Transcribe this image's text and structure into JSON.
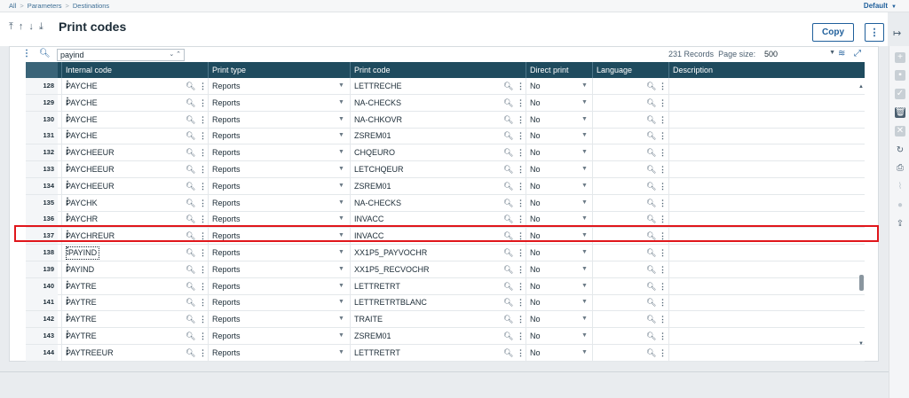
{
  "breadcrumb": [
    "All",
    "Parameters",
    "Destinations"
  ],
  "profile": {
    "label": "Default"
  },
  "header": {
    "title": "Print codes",
    "copy_label": "Copy",
    "more_label": "⋮"
  },
  "toolbar": {
    "filter_value": "payind",
    "records_count": "231",
    "records_label": "Records",
    "page_size_label": "Page size:",
    "page_size_value": "500"
  },
  "columns": {
    "internal_code": "Internal code",
    "print_type": "Print type",
    "print_code": "Print code",
    "direct_print": "Direct print",
    "language": "Language",
    "description": "Description"
  },
  "rows": [
    {
      "n": "128",
      "code": "PAYCHE",
      "type": "Reports",
      "print_code": "LETTRECHE",
      "direct": "No"
    },
    {
      "n": "129",
      "code": "PAYCHE",
      "type": "Reports",
      "print_code": "NA-CHECKS",
      "direct": "No"
    },
    {
      "n": "130",
      "code": "PAYCHE",
      "type": "Reports",
      "print_code": "NA-CHKOVR",
      "direct": "No"
    },
    {
      "n": "131",
      "code": "PAYCHE",
      "type": "Reports",
      "print_code": "ZSREM01",
      "direct": "No"
    },
    {
      "n": "132",
      "code": "PAYCHEEUR",
      "type": "Reports",
      "print_code": "CHQEURO",
      "direct": "No"
    },
    {
      "n": "133",
      "code": "PAYCHEEUR",
      "type": "Reports",
      "print_code": "LETCHQEUR",
      "direct": "No"
    },
    {
      "n": "134",
      "code": "PAYCHEEUR",
      "type": "Reports",
      "print_code": "ZSREM01",
      "direct": "No"
    },
    {
      "n": "135",
      "code": "PAYCHK",
      "type": "Reports",
      "print_code": "NA-CHECKS",
      "direct": "No"
    },
    {
      "n": "136",
      "code": "PAYCHR",
      "type": "Reports",
      "print_code": "INVACC",
      "direct": "No"
    },
    {
      "n": "137",
      "code": "PAYCHREUR",
      "type": "Reports",
      "print_code": "INVACC",
      "direct": "No"
    },
    {
      "n": "138",
      "code": "PAYIND",
      "type": "Reports",
      "print_code": "XX1P5_PAYVOCHR",
      "direct": "No"
    },
    {
      "n": "139",
      "code": "PAYIND",
      "type": "Reports",
      "print_code": "XX1P5_RECVOCHR",
      "direct": "No"
    },
    {
      "n": "140",
      "code": "PAYTRE",
      "type": "Reports",
      "print_code": "LETTRETRT",
      "direct": "No"
    },
    {
      "n": "141",
      "code": "PAYTRE",
      "type": "Reports",
      "print_code": "LETTRETRTBLANC",
      "direct": "No"
    },
    {
      "n": "142",
      "code": "PAYTRE",
      "type": "Reports",
      "print_code": "TRAITE",
      "direct": "No"
    },
    {
      "n": "143",
      "code": "PAYTRE",
      "type": "Reports",
      "print_code": "ZSREM01",
      "direct": "No"
    },
    {
      "n": "144",
      "code": "PAYTREEUR",
      "type": "Reports",
      "print_code": "LETTRETRT",
      "direct": "No"
    }
  ],
  "selected_row": "138",
  "highlighted_row": "137"
}
